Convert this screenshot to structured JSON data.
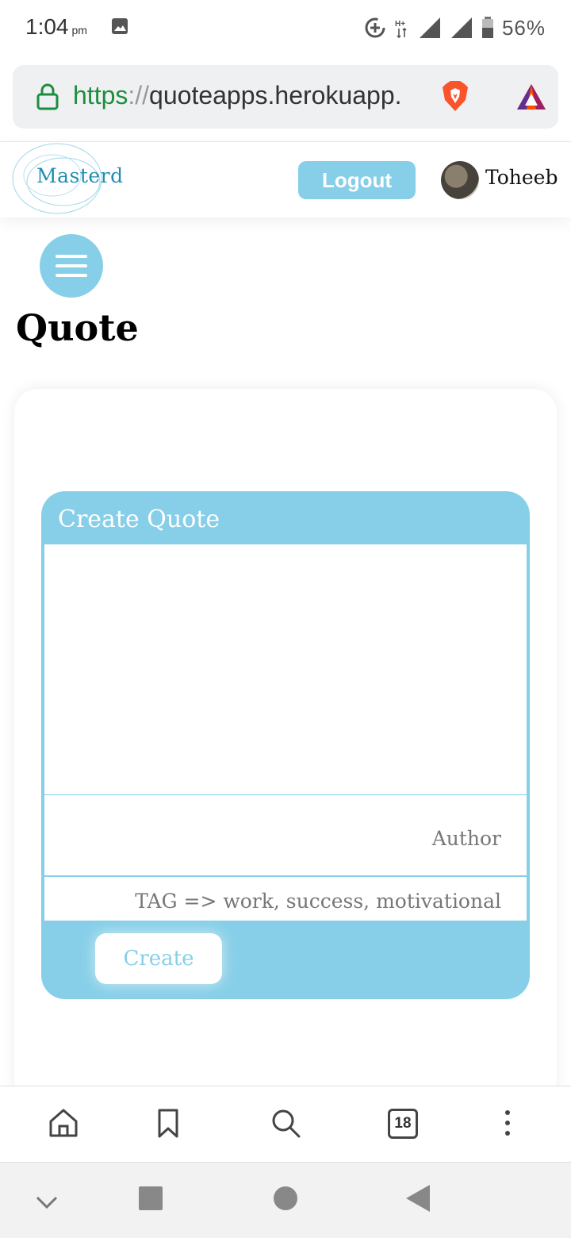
{
  "status_bar": {
    "time": "1:04",
    "ampm": "pm",
    "battery": "56%",
    "network": "H+"
  },
  "url_bar": {
    "scheme": "https",
    "separator": "://",
    "host": "quoteapps.herokuapp."
  },
  "header": {
    "logo_text": "Masterd",
    "logout_label": "Logout",
    "username": "Toheeb"
  },
  "page": {
    "title": "Quote"
  },
  "form": {
    "title": "Create Quote",
    "author_placeholder": "Author",
    "tag_placeholder": "TAG => work, success, motivational",
    "create_label": "Create"
  },
  "toolbar": {
    "tab_count": "18"
  },
  "colors": {
    "accent": "#87cfe8",
    "url_scheme": "#1e8e3e"
  }
}
